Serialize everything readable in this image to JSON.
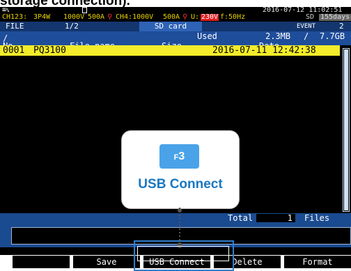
{
  "caption": "storage connection).",
  "status": {
    "row1": {
      "mode_icon": "≡",
      "mode_suffix": "%",
      "icon": "drive-icon",
      "datetime": "2016-07-12 11:02:51"
    },
    "row2": {
      "ch123": "CH123:",
      "wiring": "3P4W",
      "v1": "1000V",
      "a1": "500A",
      "ch4": "CH4:1000V",
      "a2": "500A",
      "u_label": "U:",
      "u_value": "230V",
      "freq": "f:50Hz",
      "sd": "SD",
      "days": "155days"
    }
  },
  "tabs": {
    "file": "FILE",
    "page": "1/2",
    "sd": "SD card",
    "event": "EVENT",
    "event_count": "2"
  },
  "path": {
    "dir": "/",
    "used_label": "Used",
    "used_value": "2.3MB",
    "sep": "/",
    "capacity": "7.7GB"
  },
  "columns": {
    "no": "No.",
    "name": "File name",
    "size": "Size",
    "date": "Date"
  },
  "rows": [
    {
      "no": "0001",
      "name": "PQ3100",
      "size": "",
      "date": "2016-07-11 12:42:38"
    }
  ],
  "total": {
    "label": "Total",
    "value": "1",
    "unit": "Files"
  },
  "fkeys": {
    "f1": "",
    "f2": "Save",
    "f3": "USB Connect",
    "f4": "Delete",
    "f5": "Format"
  },
  "popup": {
    "key_prefix": "F",
    "key_num": "3",
    "label": "USB Connect"
  },
  "colors": {
    "highlight_row": "#f2ec2a",
    "header_bg": "#cfe1f6",
    "accent_blue": "#1978c2"
  }
}
